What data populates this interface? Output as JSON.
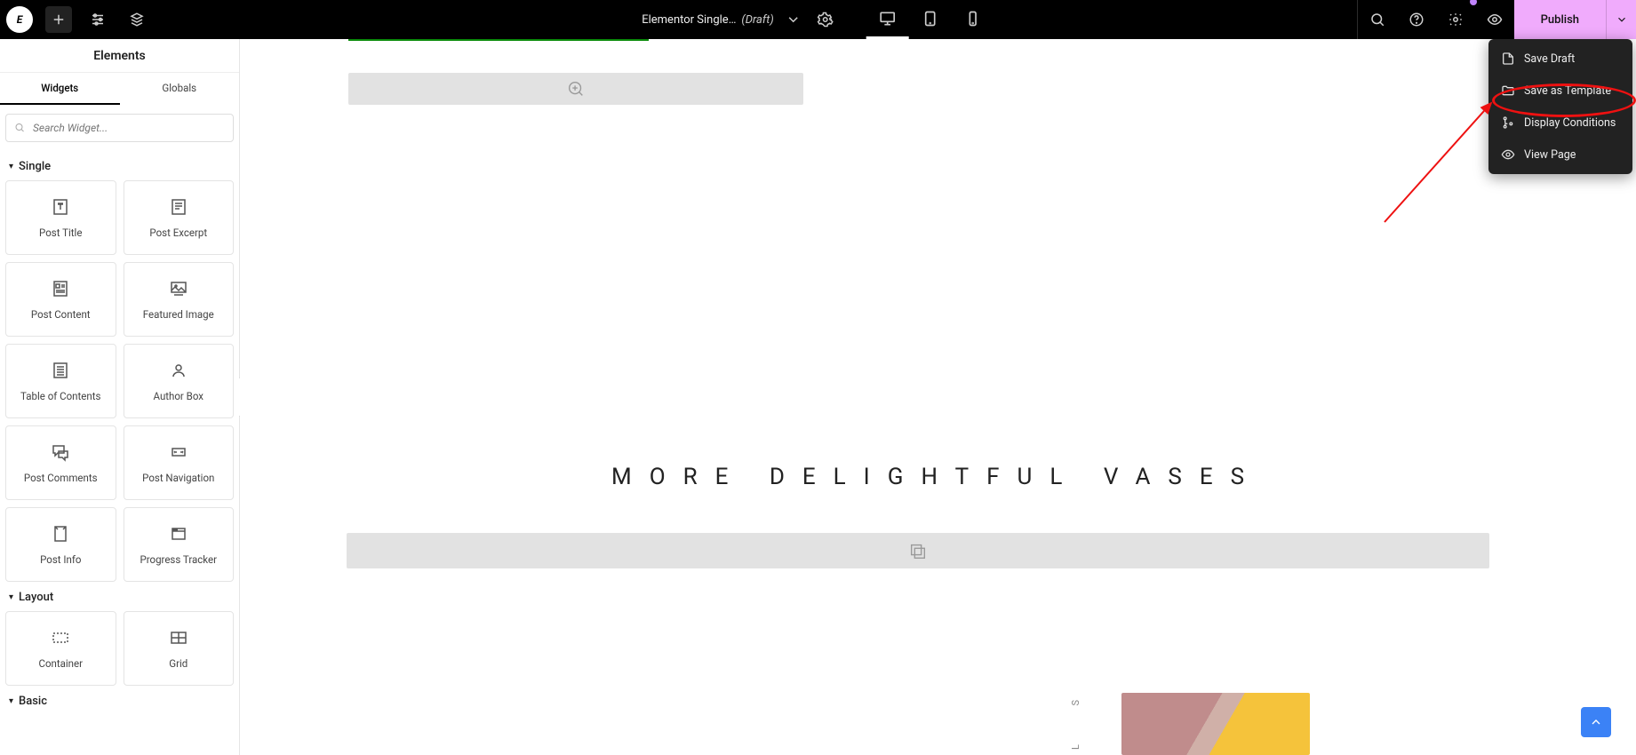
{
  "topbar": {
    "doc_title": "Elementor Single…",
    "doc_status": "(Draft)",
    "publish_label": "Publish"
  },
  "save_menu": {
    "save_draft": "Save Draft",
    "save_template": "Save as Template",
    "display_conditions": "Display Conditions",
    "view_page": "View Page"
  },
  "sidepanel": {
    "title": "Elements",
    "tabs": {
      "widgets": "Widgets",
      "globals": "Globals"
    },
    "search_placeholder": "Search Widget...",
    "cat_single": "Single",
    "cat_layout": "Layout",
    "cat_basic": "Basic",
    "widgets_single": {
      "post_title": "Post Title",
      "post_excerpt": "Post Excerpt",
      "post_content": "Post Content",
      "featured_image": "Featured Image",
      "toc": "Table of Contents",
      "author_box": "Author Box",
      "post_comments": "Post Comments",
      "post_navigation": "Post Navigation",
      "post_info": "Post Info",
      "progress_tracker": "Progress Tracker"
    },
    "widgets_layout": {
      "container": "Container",
      "grid": "Grid"
    }
  },
  "canvas": {
    "heading": "MORE DELIGHTFUL VASES",
    "side_text": "S",
    "side_text2": "L"
  }
}
